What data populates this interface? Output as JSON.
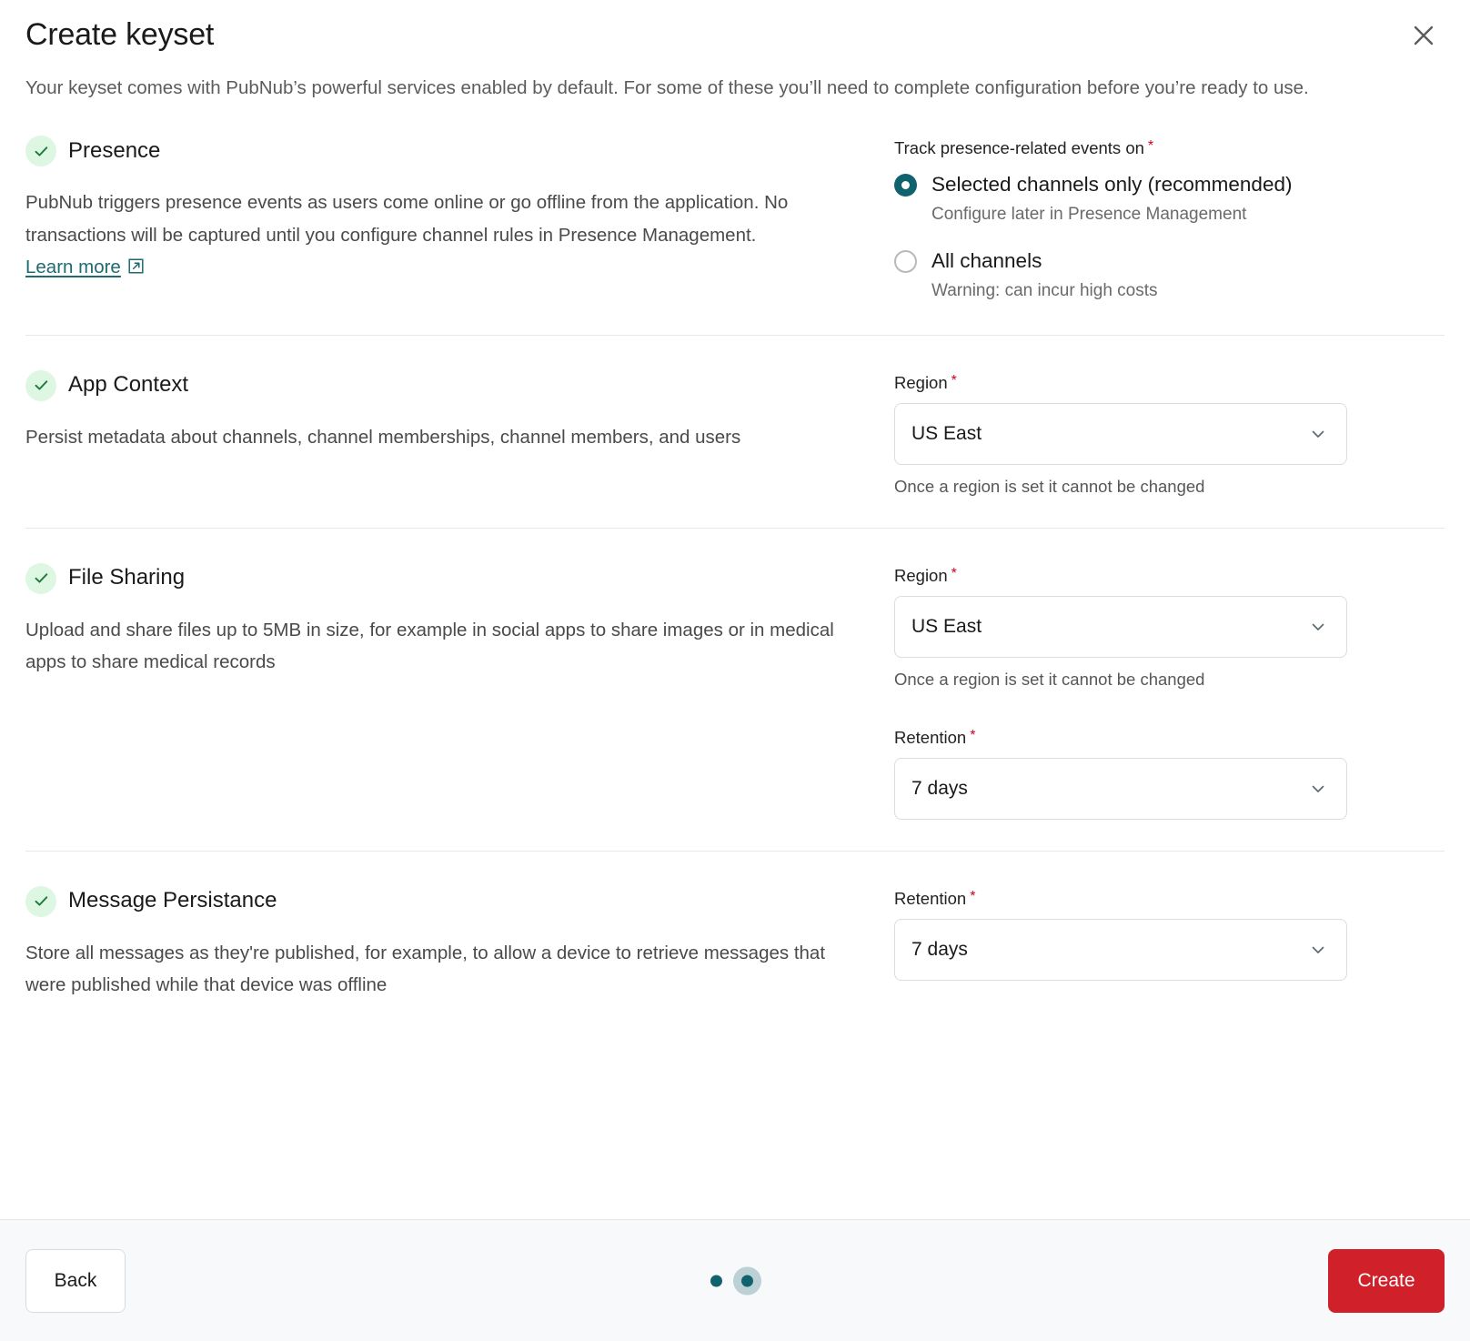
{
  "modal": {
    "title": "Create keyset",
    "subtitle": "Your keyset comes with PubNub’s powerful services enabled by default. For some of these you’ll need to complete configuration before you’re ready to use.",
    "close_icon": "close-icon"
  },
  "colors": {
    "accent_teal": "#10626e",
    "link_teal": "#1d6a72",
    "create_red": "#d0202a",
    "badge_green_bg": "#ddf7e2",
    "badge_green_check": "#1e7a3c",
    "required_red": "#d0021b"
  },
  "sections": [
    {
      "name": "Presence",
      "enabled_icon": "check-icon",
      "description_before_link": "PubNub triggers presence events as users come online or go offline from the application. No transactions will be captured until you configure channel rules in Presence Management. ",
      "link_label": "Learn more",
      "link_icon": "external-link-icon",
      "radio_group_label": "Track presence-related events on",
      "required_marker": "*",
      "options": [
        {
          "label": "Selected channels only (recommended)",
          "sublabel": "Configure later in Presence Management",
          "selected": true
        },
        {
          "label": "All channels",
          "sublabel": "Warning: can incur high costs",
          "selected": false
        }
      ]
    },
    {
      "name": "App Context",
      "enabled_icon": "check-icon",
      "description": "Persist metadata about channels, channel memberships, channel members, and users",
      "fields": [
        {
          "label": "Region",
          "required_marker": "*",
          "value": "US East",
          "hint": "Once a region is set it cannot be changed",
          "chevron_icon": "chevron-down-icon"
        }
      ]
    },
    {
      "name": "File Sharing",
      "enabled_icon": "check-icon",
      "description": "Upload and share files up to 5MB in size, for example in social apps to share images or in medical apps to share medical records",
      "fields": [
        {
          "label": "Region",
          "required_marker": "*",
          "value": "US East",
          "hint": "Once a region is set it cannot be changed",
          "chevron_icon": "chevron-down-icon"
        },
        {
          "label": "Retention",
          "required_marker": "*",
          "value": "7 days",
          "hint": "",
          "chevron_icon": "chevron-down-icon"
        }
      ]
    },
    {
      "name": "Message Persistance",
      "enabled_icon": "check-icon",
      "description": "Store all messages as they're published, for example, to allow a device to retrieve messages that were published while that device was offline",
      "fields": [
        {
          "label": "Retention",
          "required_marker": "*",
          "value": "7 days",
          "hint": "",
          "chevron_icon": "chevron-down-icon"
        }
      ]
    }
  ],
  "footer": {
    "back_label": "Back",
    "create_label": "Create",
    "pagination": {
      "total": 2,
      "active_index": 1
    }
  }
}
